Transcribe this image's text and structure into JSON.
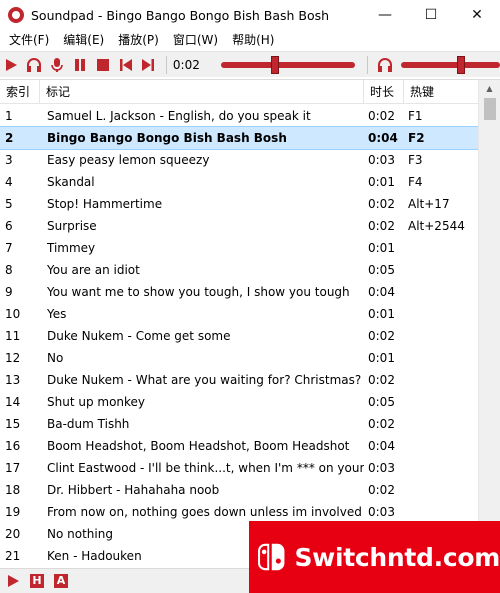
{
  "window": {
    "title": "Soundpad - Bingo Bango Bongo Bish Bash Bosh",
    "minimize": "—",
    "maximize": "☐",
    "close": "✕"
  },
  "menu": [
    "文件(F)",
    "编辑(E)",
    "播放(P)",
    "窗口(W)",
    "帮助(H)"
  ],
  "toolbar": {
    "time": "0:02",
    "progress_fraction": 0.4,
    "volume_fraction": 0.6
  },
  "list": {
    "headers": {
      "index": "索引",
      "title": "标记",
      "duration": "时长",
      "hotkey": "热键"
    },
    "selected_index": 1,
    "rows": [
      {
        "index": "1",
        "title": "Samuel L. Jackson - English, do you speak it",
        "duration": "0:02",
        "hotkey": "F1"
      },
      {
        "index": "2",
        "title": "Bingo Bango Bongo Bish Bash Bosh",
        "duration": "0:04",
        "hotkey": "F2"
      },
      {
        "index": "3",
        "title": "Easy peasy lemon squeezy",
        "duration": "0:03",
        "hotkey": "F3"
      },
      {
        "index": "4",
        "title": "Skandal",
        "duration": "0:01",
        "hotkey": "F4"
      },
      {
        "index": "5",
        "title": "Stop! Hammertime",
        "duration": "0:02",
        "hotkey": "Alt+17"
      },
      {
        "index": "6",
        "title": "Surprise",
        "duration": "0:02",
        "hotkey": "Alt+2544"
      },
      {
        "index": "7",
        "title": "Timmey",
        "duration": "0:01",
        "hotkey": ""
      },
      {
        "index": "8",
        "title": "You are an idiot",
        "duration": "0:05",
        "hotkey": ""
      },
      {
        "index": "9",
        "title": "You want me to show you tough, I show you tough",
        "duration": "0:04",
        "hotkey": ""
      },
      {
        "index": "10",
        "title": "Yes",
        "duration": "0:01",
        "hotkey": ""
      },
      {
        "index": "11",
        "title": "Duke Nukem - Come get some",
        "duration": "0:02",
        "hotkey": ""
      },
      {
        "index": "12",
        "title": "No",
        "duration": "0:01",
        "hotkey": ""
      },
      {
        "index": "13",
        "title": "Duke Nukem - What are you waiting for? Christmas?",
        "duration": "0:02",
        "hotkey": ""
      },
      {
        "index": "14",
        "title": "Shut up monkey",
        "duration": "0:05",
        "hotkey": ""
      },
      {
        "index": "15",
        "title": "Ba-dum Tishh",
        "duration": "0:02",
        "hotkey": ""
      },
      {
        "index": "16",
        "title": "Boom Headshot, Boom Headshot, Boom Headshot",
        "duration": "0:04",
        "hotkey": ""
      },
      {
        "index": "17",
        "title": "Clint Eastwood - I'll be think...t, when I'm *** on your grave",
        "duration": "0:03",
        "hotkey": ""
      },
      {
        "index": "18",
        "title": "Dr. Hibbert - Hahahaha noob",
        "duration": "0:02",
        "hotkey": ""
      },
      {
        "index": "19",
        "title": "From now on, nothing goes down unless im involved",
        "duration": "0:03",
        "hotkey": ""
      },
      {
        "index": "20",
        "title": "No nothing",
        "duration": "",
        "hotkey": ""
      },
      {
        "index": "21",
        "title": "Ken - Hadouken",
        "duration": "",
        "hotkey": ""
      }
    ]
  },
  "statusbar": {
    "h_label": "H",
    "a_label": "A"
  },
  "watermark": {
    "text": "Switchntd.com"
  },
  "colors": {
    "accent": "#c0262d",
    "selection": "#cde8ff",
    "watermark": "#e60012"
  },
  "icons": {
    "toolbar": [
      "play-icon",
      "headphones-icon",
      "microphone-icon",
      "pause-icon",
      "stop-icon",
      "previous-icon",
      "next-icon"
    ],
    "volume": "headphones-icon"
  }
}
